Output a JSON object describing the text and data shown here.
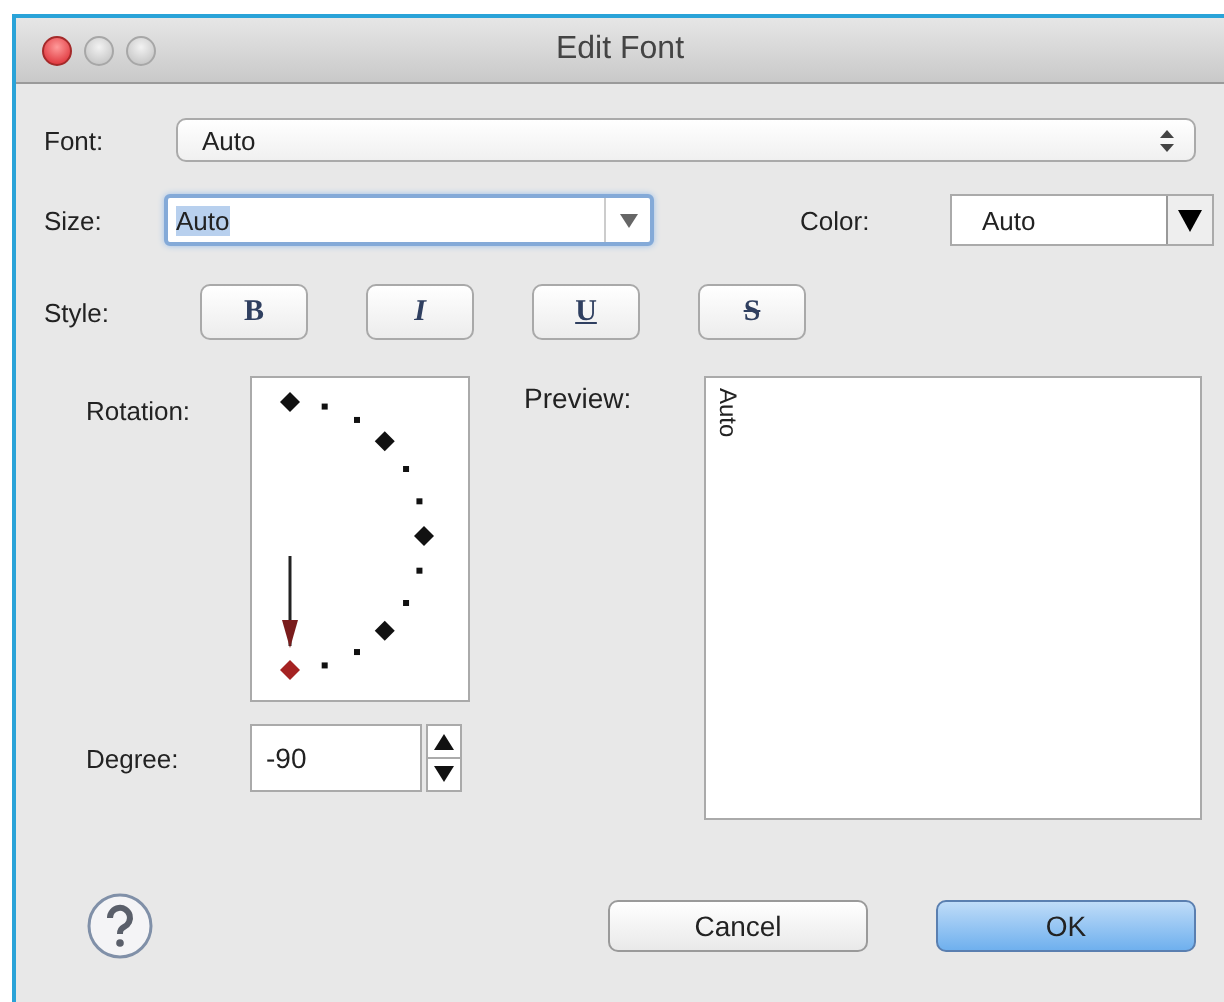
{
  "window": {
    "title": "Edit Font"
  },
  "font": {
    "label": "Font:",
    "value": "Auto"
  },
  "size": {
    "label": "Size:",
    "value": "Auto"
  },
  "color": {
    "label": "Color:",
    "value": "Auto"
  },
  "style": {
    "label": "Style:",
    "buttons": [
      {
        "label": "B",
        "kind": "bold"
      },
      {
        "label": "I",
        "kind": "italic"
      },
      {
        "label": "U",
        "kind": "underline"
      },
      {
        "label": "S",
        "kind": "strike"
      }
    ]
  },
  "rotation": {
    "label": "Rotation:",
    "positions": [
      {
        "selected": false
      },
      {
        "selected": false
      },
      {
        "selected": false
      },
      {
        "selected": false
      },
      {
        "selected": true
      }
    ]
  },
  "degree": {
    "label": "Degree:",
    "value": "-90"
  },
  "preview": {
    "label": "Preview:",
    "text": "Auto"
  },
  "buttons": [
    {
      "label": "Cancel",
      "kind": "default"
    },
    {
      "label": "OK",
      "kind": "primary"
    }
  ]
}
